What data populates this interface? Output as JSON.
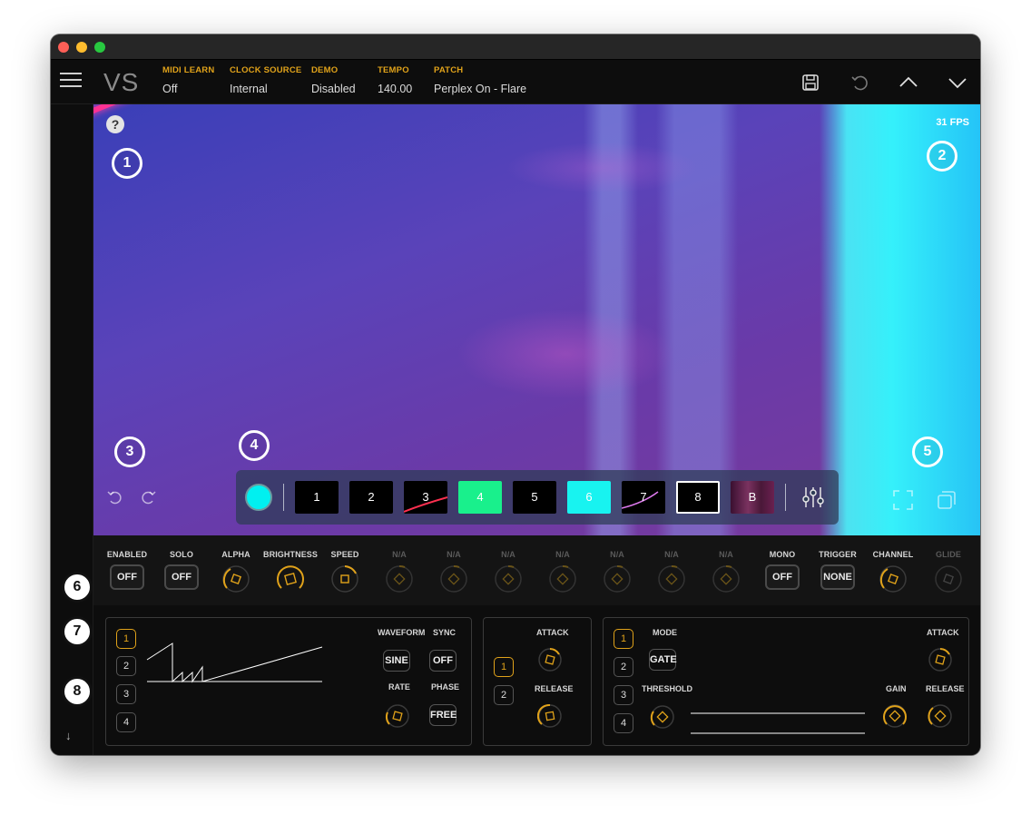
{
  "window": {
    "title": ""
  },
  "topbar": {
    "logo": "VS",
    "fields": [
      {
        "key": "MIDI LEARN",
        "value": "Off"
      },
      {
        "key": "CLOCK SOURCE",
        "value": "Internal"
      },
      {
        "key": "DEMO",
        "value": "Disabled"
      },
      {
        "key": "TEMPO",
        "value": "140.00"
      },
      {
        "key": "PATCH",
        "value": "Perplex On - Flare"
      }
    ],
    "icons": [
      "save-icon",
      "undo-icon",
      "chevron-up-icon",
      "chevron-down-icon"
    ]
  },
  "viewport": {
    "help": "?",
    "fps": "31 FPS",
    "callouts": [
      "1",
      "2",
      "3",
      "4",
      "5"
    ],
    "layers": [
      "1",
      "2",
      "3",
      "4",
      "5",
      "6",
      "7",
      "8",
      "B"
    ],
    "selected_layer": "8",
    "accent_color": "#00f0f0"
  },
  "controls": {
    "callout": "6",
    "items": [
      {
        "label": "ENABLED",
        "kind": "pill",
        "value": "OFF"
      },
      {
        "label": "SOLO",
        "kind": "pill",
        "value": "OFF"
      },
      {
        "label": "ALPHA",
        "kind": "knob"
      },
      {
        "label": "BRIGHTNESS",
        "kind": "knob"
      },
      {
        "label": "SPEED",
        "kind": "knob"
      },
      {
        "label": "N/A",
        "kind": "knob-dim"
      },
      {
        "label": "N/A",
        "kind": "knob-dim"
      },
      {
        "label": "N/A",
        "kind": "knob-dim"
      },
      {
        "label": "N/A",
        "kind": "knob-dim"
      },
      {
        "label": "N/A",
        "kind": "knob-dim"
      },
      {
        "label": "N/A",
        "kind": "knob-dim"
      },
      {
        "label": "N/A",
        "kind": "knob-dim"
      },
      {
        "label": "MONO",
        "kind": "pill",
        "value": "OFF"
      },
      {
        "label": "TRIGGER",
        "kind": "pill",
        "value": "NONE"
      },
      {
        "label": "CHANNEL",
        "kind": "knob"
      },
      {
        "label": "GLIDE",
        "kind": "knob-dim"
      }
    ]
  },
  "lfo": {
    "callout": "7",
    "slots": [
      "1",
      "2",
      "3",
      "4"
    ],
    "waveform_label": "WAVEFORM",
    "waveform_value": "SINE",
    "sync_label": "SYNC",
    "sync_value": "OFF",
    "rate_label": "RATE",
    "phase_label": "PHASE",
    "phase_value": "FREE"
  },
  "envelope": {
    "slots": [
      "1",
      "2"
    ],
    "attack_label": "ATTACK",
    "release_label": "RELEASE"
  },
  "audio": {
    "callout": "8",
    "slots": [
      "1",
      "2",
      "3",
      "4"
    ],
    "mode_label": "MODE",
    "mode_value": "GATE",
    "threshold_label": "THRESHOLD",
    "gain_label": "GAIN",
    "attack_label": "ATTACK",
    "release_label": "RELEASE"
  },
  "colors": {
    "accent": "#e0a21a",
    "green": "#19f08c",
    "cyan": "#18f3f0"
  }
}
